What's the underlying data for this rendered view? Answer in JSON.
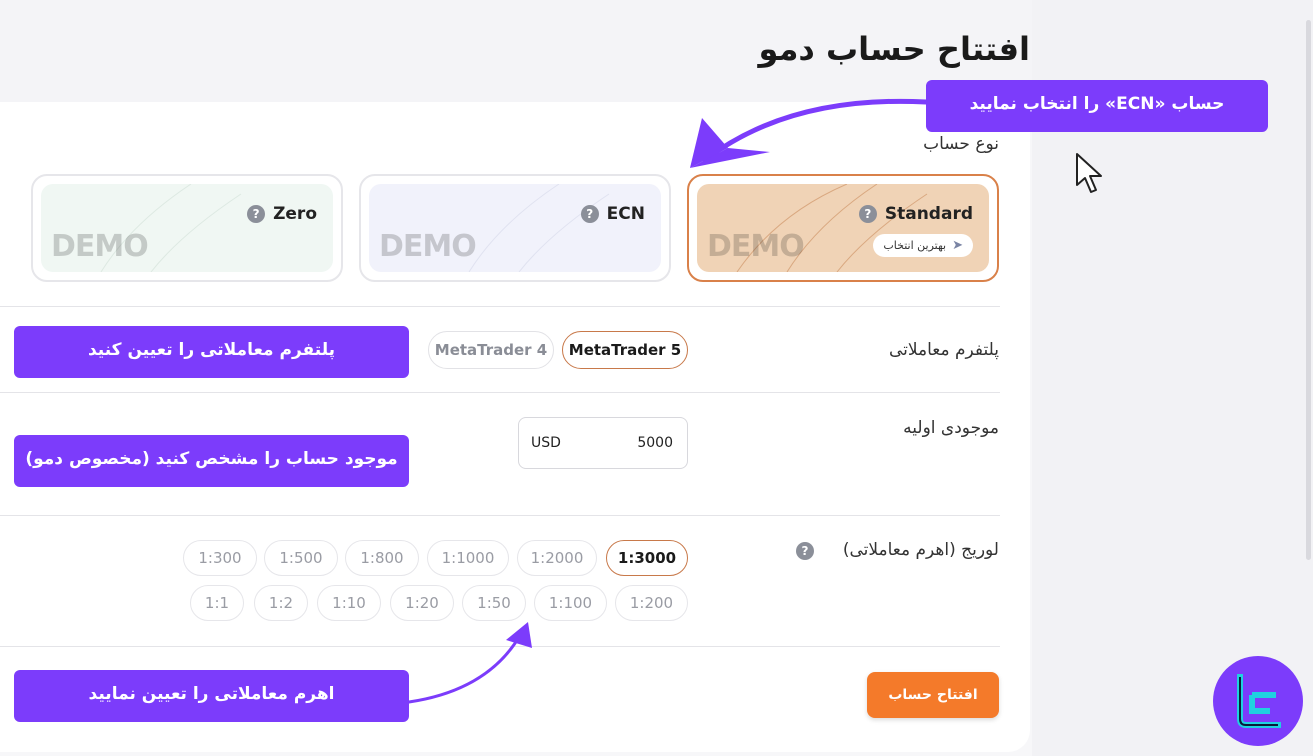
{
  "page_title": "افتتاح حساب دمو",
  "account_type": {
    "label": "نوع حساب",
    "options": [
      {
        "name": "Standard",
        "demo": "DEMO",
        "badge": "بهترین انتخاب",
        "help": "?"
      },
      {
        "name": "ECN",
        "demo": "DEMO",
        "help": "?"
      },
      {
        "name": "Zero",
        "demo": "DEMO",
        "help": "?"
      }
    ],
    "selected": "Standard"
  },
  "platform": {
    "label": "پلتفرم معاملاتی",
    "options": [
      "MetaTrader 5",
      "MetaTrader 4"
    ],
    "selected": "MetaTrader 5"
  },
  "balance": {
    "label": "موجودی اولیه",
    "currency": "USD",
    "value": "5000"
  },
  "leverage": {
    "label": "لوریج (اهرم معاملاتی)",
    "help": "?",
    "row1": [
      "1:3000",
      "1:2000",
      "1:1000",
      "1:800",
      "1:500",
      "1:300"
    ],
    "row2": [
      "1:200",
      "1:100",
      "1:50",
      "1:20",
      "1:10",
      "1:2",
      "1:1"
    ],
    "selected": "1:3000"
  },
  "open_button": "افتتاح حساب",
  "annotations": {
    "select_ecn": "حساب «ECN» را انتخاب نمایید",
    "set_platform": "پلتفرم معاملاتی را تعیین کنید",
    "set_balance": "موجود حساب را مشخص کنید (مخصوص دمو)",
    "set_leverage": "اهرم معاملاتی را تعیین نمایید"
  },
  "colors": {
    "accent_orange": "#f47a2a",
    "annotation_purple": "#7c3cfb",
    "selected_border": "#d9814a"
  },
  "icons": [
    "help-icon",
    "rocket-icon",
    "mouse-cursor-icon",
    "brand-logo-icon"
  ]
}
